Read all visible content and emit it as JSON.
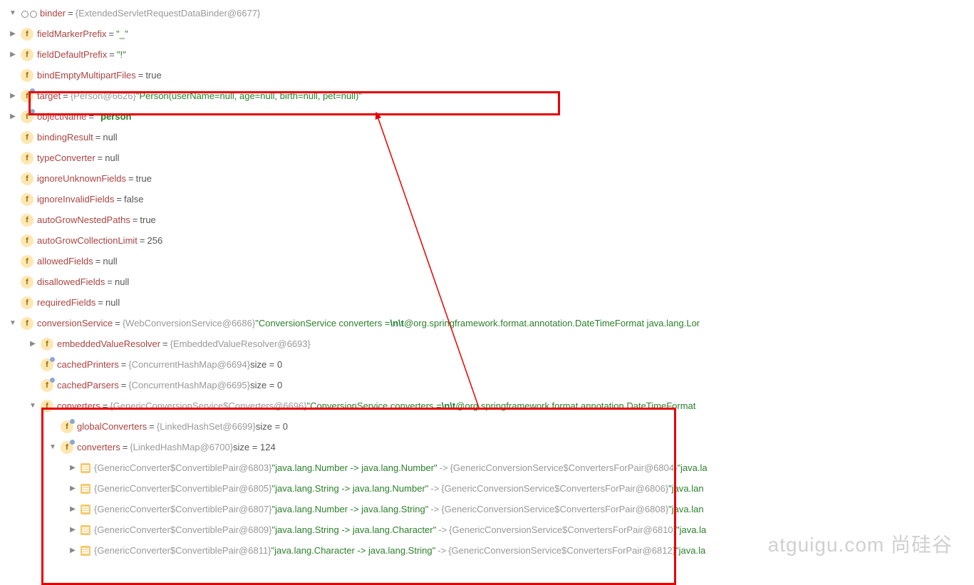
{
  "root": {
    "name": "binder",
    "value_obj": "{ExtendedServletRequestDataBinder@6677}"
  },
  "rows": [
    {
      "indent": 1,
      "chevron": "right",
      "icon": "f",
      "name": "fieldMarkerPrefix",
      "eq": "=",
      "val_str": "\"_\""
    },
    {
      "indent": 1,
      "chevron": "right",
      "icon": "f",
      "name": "fieldDefaultPrefix",
      "eq": "=",
      "val_str": "\"!\""
    },
    {
      "indent": 1,
      "chevron": "blank",
      "icon": "f",
      "name": "bindEmptyMultipartFiles",
      "eq": "=",
      "val_kw": "true"
    },
    {
      "indent": 1,
      "chevron": "right",
      "icon": "fhat",
      "name": "target",
      "eq": "=",
      "val_obj": "{Person@6626} ",
      "val_str": "\"Person(userName=null, age=null, birth=null, pet=null)\""
    },
    {
      "indent": 1,
      "chevron": "right",
      "icon": "fhat",
      "name": "objectName",
      "eq": "=",
      "val_str_bold": "\"person\""
    },
    {
      "indent": 1,
      "chevron": "blank",
      "icon": "f",
      "name": "bindingResult",
      "eq": "=",
      "val_kw": "null"
    },
    {
      "indent": 1,
      "chevron": "blank",
      "icon": "f",
      "name": "typeConverter",
      "eq": "=",
      "val_kw": "null"
    },
    {
      "indent": 1,
      "chevron": "blank",
      "icon": "f",
      "name": "ignoreUnknownFields",
      "eq": "=",
      "val_kw": "true"
    },
    {
      "indent": 1,
      "chevron": "blank",
      "icon": "f",
      "name": "ignoreInvalidFields",
      "eq": "=",
      "val_kw": "false"
    },
    {
      "indent": 1,
      "chevron": "blank",
      "icon": "f",
      "name": "autoGrowNestedPaths",
      "eq": "=",
      "val_kw": "true"
    },
    {
      "indent": 1,
      "chevron": "blank",
      "icon": "f",
      "name": "autoGrowCollectionLimit",
      "eq": "=",
      "val_kw": "256"
    },
    {
      "indent": 1,
      "chevron": "blank",
      "icon": "f",
      "name": "allowedFields",
      "eq": "=",
      "val_kw": "null"
    },
    {
      "indent": 1,
      "chevron": "blank",
      "icon": "f",
      "name": "disallowedFields",
      "eq": "=",
      "val_kw": "null"
    },
    {
      "indent": 1,
      "chevron": "blank",
      "icon": "f",
      "name": "requiredFields",
      "eq": "=",
      "val_kw": "null"
    },
    {
      "indent": 1,
      "chevron": "down",
      "icon": "f",
      "name": "conversionService",
      "eq": "=",
      "val_obj": "{WebConversionService@6686} ",
      "val_str_plain": "\"ConversionService converters =",
      "val_esc": "\\n\\t",
      "val_str_suffix": "@org.springframework.format.annotation.DateTimeFormat java.lang.Lor"
    },
    {
      "indent": 2,
      "chevron": "right",
      "icon": "f",
      "name": "embeddedValueResolver",
      "eq": "=",
      "val_obj": "{EmbeddedValueResolver@6693}"
    },
    {
      "indent": 2,
      "chevron": "blank",
      "icon": "fhat",
      "name": "cachedPrinters",
      "eq": "=",
      "val_obj": "{ConcurrentHashMap@6694} ",
      "val_extra": " size = 0"
    },
    {
      "indent": 2,
      "chevron": "blank",
      "icon": "fhat",
      "name": "cachedParsers",
      "eq": "=",
      "val_obj": "{ConcurrentHashMap@6695} ",
      "val_extra": " size = 0"
    },
    {
      "indent": 2,
      "chevron": "down",
      "icon": "f",
      "name": "converters",
      "eq": "=",
      "val_obj": "{GenericConversionService$Converters@6696} ",
      "val_str_plain": "\"ConversionService converters =",
      "val_esc": "\\n\\t",
      "val_str_suffix": "@org.springframework.format.annotation.DateTimeFormat "
    },
    {
      "indent": 3,
      "chevron": "blank",
      "icon": "fhat",
      "name": "globalConverters",
      "eq": "=",
      "val_obj": "{LinkedHashSet@6699} ",
      "val_extra": " size = 0"
    },
    {
      "indent": 3,
      "chevron": "down",
      "icon": "fhat",
      "name": "converters",
      "eq": "=",
      "val_obj": "{LinkedHashMap@6700} ",
      "val_extra": " size = 124"
    },
    {
      "indent": 4,
      "chevron": "right",
      "icon": "entry",
      "val_obj": "{GenericConverter$ConvertiblePair@6803} ",
      "val_str": "\"java.lang.Number -> java.lang.Number\"",
      "map_arrow": "->",
      "val_obj2": "{GenericConversionService$ConvertersForPair@6804} ",
      "val_str2": "\"java.la"
    },
    {
      "indent": 4,
      "chevron": "right",
      "icon": "entry",
      "val_obj": "{GenericConverter$ConvertiblePair@6805} ",
      "val_str": "\"java.lang.String -> java.lang.Number\"",
      "map_arrow": "->",
      "val_obj2": "{GenericConversionService$ConvertersForPair@6806} ",
      "val_str2": "\"java.lan"
    },
    {
      "indent": 4,
      "chevron": "right",
      "icon": "entry",
      "val_obj": "{GenericConverter$ConvertiblePair@6807} ",
      "val_str": "\"java.lang.Number -> java.lang.String\"",
      "map_arrow": "->",
      "val_obj2": "{GenericConversionService$ConvertersForPair@6808} ",
      "val_str2": "\"java.lan"
    },
    {
      "indent": 4,
      "chevron": "right",
      "icon": "entry",
      "val_obj": "{GenericConverter$ConvertiblePair@6809} ",
      "val_str": "\"java.lang.String -> java.lang.Character\"",
      "map_arrow": "->",
      "val_obj2": "{GenericConversionService$ConvertersForPair@6810} ",
      "val_str2": "\"java.la"
    },
    {
      "indent": 4,
      "chevron": "right",
      "icon": "entry",
      "val_obj": "{GenericConverter$ConvertiblePair@6811} ",
      "val_str": "\"java.lang.Character -> java.lang.String\"",
      "map_arrow": "->",
      "val_obj2": "{GenericConversionService$ConvertersForPair@6812} ",
      "val_str2": "\"java.la"
    }
  ],
  "watermark": "atguigu.com 尚硅谷"
}
